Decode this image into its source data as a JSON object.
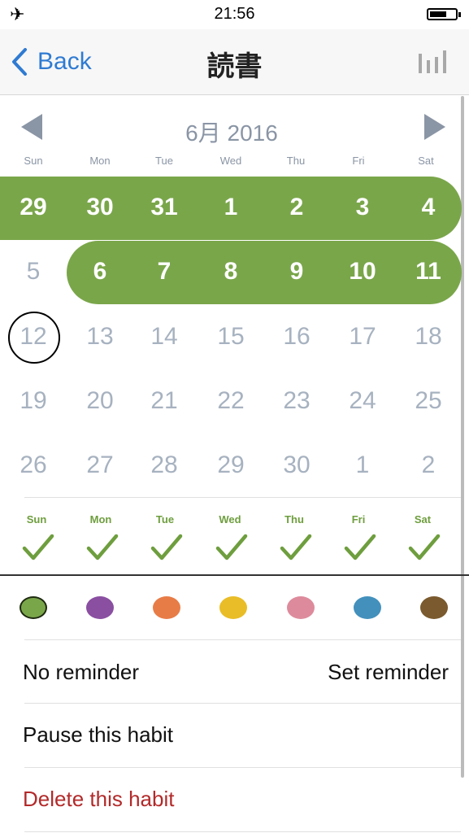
{
  "status_bar": {
    "time": "21:56",
    "airplane_icon": "airplane-icon",
    "battery_icon": "battery-icon"
  },
  "navbar": {
    "back_label": "Back",
    "title": "読書",
    "stats_icon": "bar-chart-icon"
  },
  "calendar": {
    "month_label": "6月 2016",
    "weekdays": [
      "Sun",
      "Mon",
      "Tue",
      "Wed",
      "Thu",
      "Fri",
      "Sat"
    ],
    "weeks": [
      [
        "29",
        "30",
        "31",
        "1",
        "2",
        "3",
        "4"
      ],
      [
        "5",
        "6",
        "7",
        "8",
        "9",
        "10",
        "11"
      ],
      [
        "12",
        "13",
        "14",
        "15",
        "16",
        "17",
        "18"
      ],
      [
        "19",
        "20",
        "21",
        "22",
        "23",
        "24",
        "25"
      ],
      [
        "26",
        "27",
        "28",
        "29",
        "30",
        "1",
        "2"
      ]
    ],
    "today": "12",
    "completed_color": "#7aa64a"
  },
  "frequency": {
    "days": [
      "Sun",
      "Mon",
      "Tue",
      "Wed",
      "Thu",
      "Fri",
      "Sat"
    ],
    "checked": [
      true,
      true,
      true,
      true,
      true,
      true,
      true
    ]
  },
  "colors": {
    "selected": "#7aa64a",
    "options": [
      "#7aa64a",
      "#8a4fa1",
      "#e87c47",
      "#e9bd27",
      "#dd8b9c",
      "#4390bd",
      "#7a5a2e"
    ]
  },
  "settings": {
    "reminder_status": "No reminder",
    "set_reminder_label": "Set reminder",
    "pause_label": "Pause this habit",
    "delete_label": "Delete this habit",
    "delete_color": "#b32a2a"
  }
}
